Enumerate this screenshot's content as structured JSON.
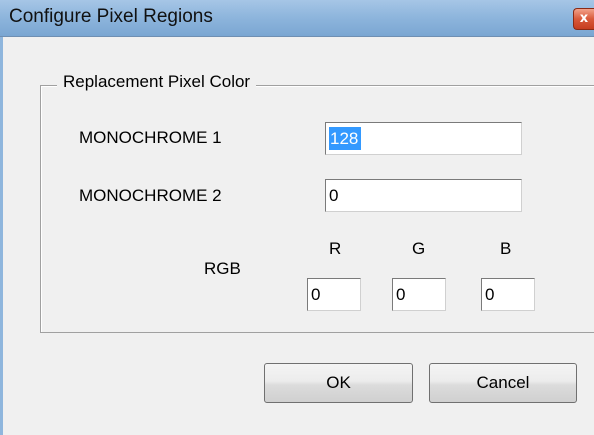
{
  "window": {
    "title": "Configure Pixel Regions",
    "close_symbol": "x"
  },
  "group": {
    "legend": "Replacement Pixel Color"
  },
  "fields": {
    "mono1": {
      "label": "MONOCHROME 1",
      "value": "128"
    },
    "mono2": {
      "label": "MONOCHROME 2",
      "value": "0"
    },
    "rgb": {
      "label": "RGB",
      "r": {
        "label": "R",
        "value": "0"
      },
      "g": {
        "label": "G",
        "value": "0"
      },
      "b": {
        "label": "B",
        "value": "0"
      }
    }
  },
  "buttons": {
    "ok": "OK",
    "cancel": "Cancel"
  },
  "colors": {
    "selection": "#3399ff",
    "title_bar": "#8fb6dd",
    "close_button": "#d9593a"
  }
}
